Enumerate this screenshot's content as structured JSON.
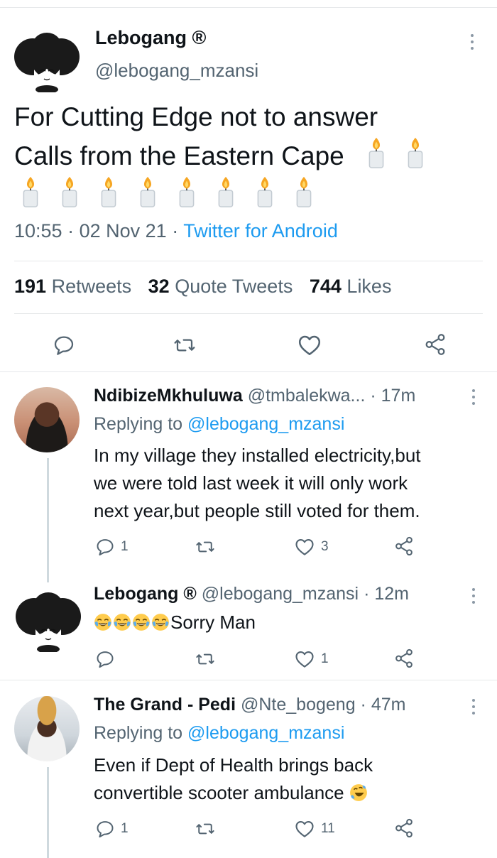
{
  "main_tweet": {
    "display_name": "Lebogang ®",
    "handle": "@lebogang_mzansi",
    "text_line1": "For Cutting Edge not to answer",
    "text_line2": "Calls from the Eastern Cape",
    "time": "10:55",
    "date": "02 Nov 21",
    "source": "Twitter for Android",
    "retweets_count": "191",
    "retweets_label": "Retweets",
    "quotes_count": "32",
    "quotes_label": "Quote Tweets",
    "likes_count": "744",
    "likes_label": "Likes"
  },
  "replies": [
    {
      "display_name": "NdibizeMkhuluwa",
      "handle": "@tmbalekwa...",
      "time": "17m",
      "replying_prefix": "Replying to",
      "replying_to": "@lebogang_mzansi",
      "line1": "In my village they installed electricity,but",
      "line2": "we were told last week it will only work",
      "line3": "next year,but people still voted for them.",
      "reply_count": "1",
      "like_count": "3"
    },
    {
      "display_name": "Lebogang ®",
      "handle": "@lebogang_mzansi",
      "time": "12m",
      "text": "Sorry Man",
      "like_count": "1"
    },
    {
      "display_name": "The Grand - Pedi",
      "handle": "@Nte_bogeng",
      "time": "47m",
      "replying_prefix": "Replying to",
      "replying_to": "@lebogang_mzansi",
      "line1": "Even if Dept of Health brings back",
      "line2": "convertible scooter ambulance",
      "reply_count": "1",
      "like_count": "11"
    }
  ],
  "separator": "·",
  "icons": [
    "reply-icon",
    "retweet-icon",
    "like-icon",
    "share-icon",
    "more-icon",
    "candle-emoji-icon",
    "tears-of-joy-emoji-icon",
    "rofl-emoji-icon"
  ],
  "colors": {
    "link": "#1d9bf0",
    "secondary_text": "#536471",
    "primary_text": "#0f1419",
    "divider": "#e6e8ea"
  }
}
